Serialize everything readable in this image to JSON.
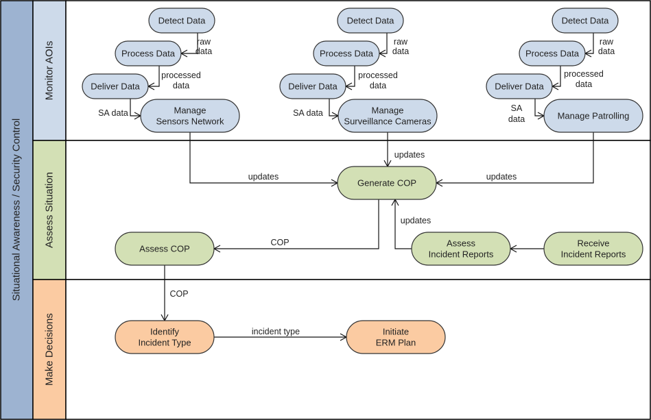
{
  "diagram": {
    "pool_title": "Situational Awareness / Security Control",
    "colors": {
      "pool": "#9db3d1",
      "monitor": "#cddaea",
      "assess": "#d3e0b5",
      "decide": "#fbcba2",
      "border": "#000000"
    },
    "lanes": [
      {
        "id": "monitor",
        "label": "Monitor AOIs"
      },
      {
        "id": "assess",
        "label": "Assess Situation"
      },
      {
        "id": "decide",
        "label": "Make Decisions"
      }
    ],
    "nodes": [
      {
        "id": "detect1",
        "lane": "monitor",
        "lines": [
          "Detect Data"
        ]
      },
      {
        "id": "process1",
        "lane": "monitor",
        "lines": [
          "Process Data"
        ]
      },
      {
        "id": "deliver1",
        "lane": "monitor",
        "lines": [
          "Deliver Data"
        ]
      },
      {
        "id": "sensors",
        "lane": "monitor",
        "lines": [
          "Manage",
          "Sensors Network"
        ]
      },
      {
        "id": "detect2",
        "lane": "monitor",
        "lines": [
          "Detect Data"
        ]
      },
      {
        "id": "process2",
        "lane": "monitor",
        "lines": [
          "Process Data"
        ]
      },
      {
        "id": "deliver2",
        "lane": "monitor",
        "lines": [
          "Deliver Data"
        ]
      },
      {
        "id": "cameras",
        "lane": "monitor",
        "lines": [
          "Manage",
          "Surveillance Cameras"
        ]
      },
      {
        "id": "detect3",
        "lane": "monitor",
        "lines": [
          "Detect Data"
        ]
      },
      {
        "id": "process3",
        "lane": "monitor",
        "lines": [
          "Process Data"
        ]
      },
      {
        "id": "deliver3",
        "lane": "monitor",
        "lines": [
          "Deliver Data"
        ]
      },
      {
        "id": "patrol",
        "lane": "monitor",
        "lines": [
          "Manage Patrolling"
        ]
      },
      {
        "id": "gencop",
        "lane": "assess",
        "lines": [
          "Generate COP"
        ]
      },
      {
        "id": "assesscop",
        "lane": "assess",
        "lines": [
          "Assess COP"
        ]
      },
      {
        "id": "assessir",
        "lane": "assess",
        "lines": [
          "Assess",
          "Incident Reports"
        ]
      },
      {
        "id": "receiveir",
        "lane": "assess",
        "lines": [
          "Receive",
          "Incident Reports"
        ]
      },
      {
        "id": "identify",
        "lane": "decide",
        "lines": [
          "Identify",
          "Incident Type"
        ]
      },
      {
        "id": "erm",
        "lane": "decide",
        "lines": [
          "Initiate",
          "ERM Plan"
        ]
      }
    ],
    "edges": [
      {
        "from": "detect1",
        "to": "process1",
        "label": [
          "raw",
          "data"
        ]
      },
      {
        "from": "process1",
        "to": "deliver1",
        "label": [
          "processed",
          "data"
        ]
      },
      {
        "from": "deliver1",
        "to": "sensors",
        "label": [
          "SA data"
        ]
      },
      {
        "from": "detect2",
        "to": "process2",
        "label": [
          "raw",
          "data"
        ]
      },
      {
        "from": "process2",
        "to": "deliver2",
        "label": [
          "processed",
          "data"
        ]
      },
      {
        "from": "deliver2",
        "to": "cameras",
        "label": [
          "SA data"
        ]
      },
      {
        "from": "detect3",
        "to": "process3",
        "label": [
          "raw",
          "data"
        ]
      },
      {
        "from": "process3",
        "to": "deliver3",
        "label": [
          "processed",
          "data"
        ]
      },
      {
        "from": "deliver3",
        "to": "patrol",
        "label": [
          "SA",
          "data"
        ]
      },
      {
        "from": "sensors",
        "to": "gencop",
        "label": [
          "updates"
        ]
      },
      {
        "from": "cameras",
        "to": "gencop",
        "label": [
          "updates"
        ]
      },
      {
        "from": "patrol",
        "to": "gencop",
        "label": [
          "updates"
        ]
      },
      {
        "from": "assessir",
        "to": "gencop",
        "label": [
          "updates"
        ]
      },
      {
        "from": "gencop",
        "to": "assesscop",
        "label": [
          "COP"
        ]
      },
      {
        "from": "receiveir",
        "to": "assessir",
        "label": []
      },
      {
        "from": "assesscop",
        "to": "identify",
        "label": [
          "COP"
        ]
      },
      {
        "from": "identify",
        "to": "erm",
        "label": [
          "incident type"
        ]
      }
    ]
  }
}
